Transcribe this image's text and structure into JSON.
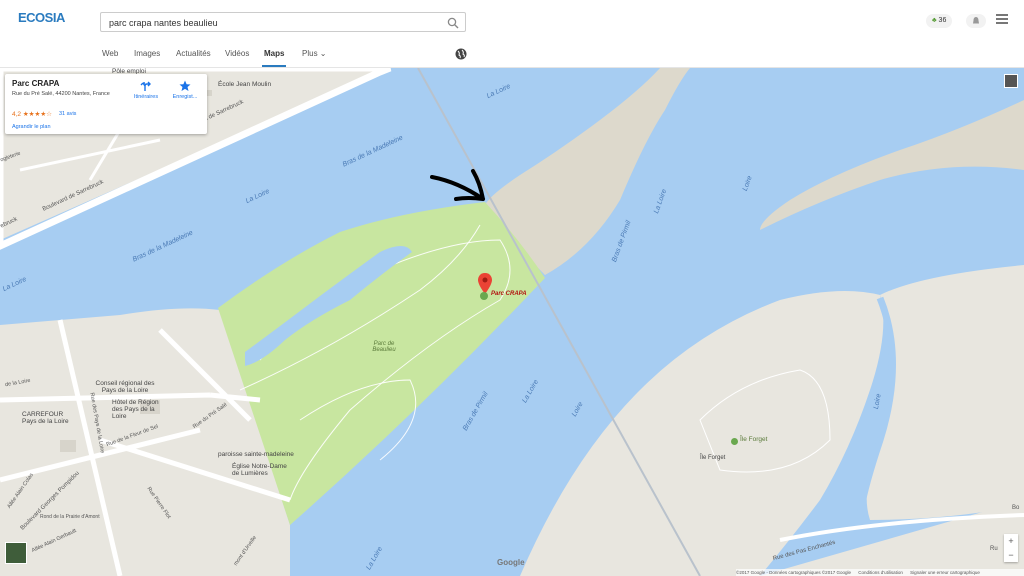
{
  "search": {
    "query": "parc crapa nantes beaulieu"
  },
  "header": {
    "logo": "ECOSIA",
    "trees_count": "36"
  },
  "nav": {
    "tabs": [
      "Web",
      "Images",
      "Actualités",
      "Vidéos",
      "Maps",
      "Plus"
    ],
    "active": "Maps"
  },
  "infocard": {
    "title": "Parc CRAPA",
    "address": "Rue du Pré Salé, 44200 Nantes, France",
    "rating": "4,2 ★★★★☆",
    "reviews": "31 avis",
    "enlarge": "Agrandir le plan",
    "directions": "Itinéraires",
    "save": "Enregist..."
  },
  "map": {
    "labels": {
      "loire_top": "La Loire",
      "bras_madeleine_1": "Bras de la Madeleine",
      "loire_left": "La Loire",
      "bras_madeleine_2": "Bras de la Madeleine",
      "loire_far_left": "La Loire",
      "bras_pirmil_1": "Bras de Pirmil",
      "loire_mid": "La Loire",
      "loire_right": "Loire",
      "bras_pirmil_2": "Bras de Pirmil",
      "loire_lower": "La Loire",
      "loire_lower2": "Loire",
      "loire_bottom": "La Loire",
      "loire_side": "Loire",
      "parc_beaulieu": "Parc de Beaulieu",
      "parc_crapa": "Parc CRAPA",
      "ile_forget": "Île Forget",
      "ile_forget_small": "Île Forget",
      "conseil": "Conseil régional des Pays de la Loire",
      "hotel_region": "Hôtel de Région des Pays de la Loire",
      "carrefour": "CARREFOUR Pays de la Loire",
      "paroisse": "paroisse sainte-madeleine",
      "eglise": "Église Notre-Dame de Lumières",
      "ecole": "École Jean Moulin",
      "pole_emploi": "Pôle emploi",
      "bd_sarrebruck_1": "Boulevard de Sarrebruck",
      "bd_sarrebruck_2": "Boulevard de Sarrebruck",
      "rue_pre_sale": "Rue du Pré Salé",
      "rue_loire": "de la Loire",
      "rue_fleur": "Rue de la Fleur de Sel",
      "rue_pays": "Rue des Pays de la Loire",
      "rue_pierre": "Rue Pierre Flot",
      "bd_pompidou": "Boulevard Georges Pompidou",
      "allee_colas": "Allée Alain Colas",
      "allee_gerbault": "Allée Alain Gerbault",
      "prairie": "Rond de la Prairie d'Amont",
      "vincelle": "mont d'Urvelle",
      "pas_enchantes": "Rue des Pas Enchantés",
      "ru": "Ru",
      "bo": "Bo",
      "giere": "ogleterie",
      "ebruck": "ebruck"
    }
  },
  "footer": {
    "copyright": "©2017 Google - Données cartographiques ©2017 Google",
    "terms": "Conditions d'utilisation",
    "report": "Signaler une erreur cartographique"
  },
  "zoom": {
    "in": "+",
    "out": "−"
  },
  "google_logo": "Google",
  "colors": {
    "water": "#a7cdf2",
    "land": "#e8e6df",
    "park": "#c8e6a0",
    "sand": "#ddd9cc",
    "road": "#ffffff",
    "pin": "#ea4335"
  }
}
